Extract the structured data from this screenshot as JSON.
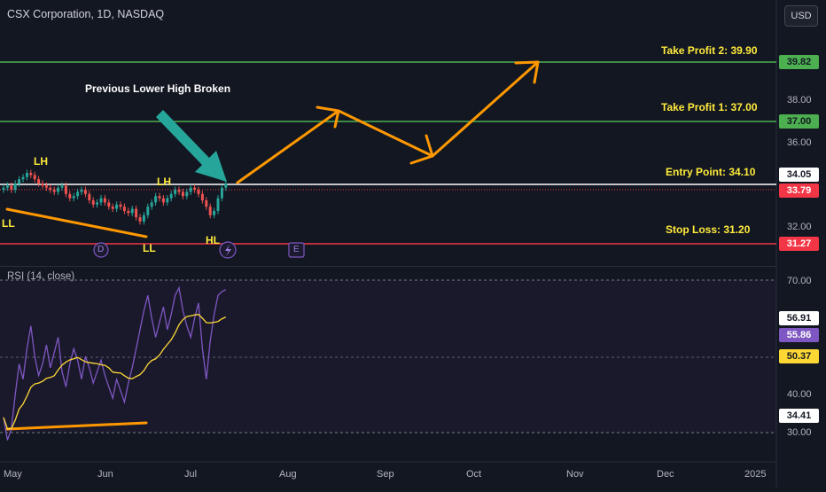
{
  "header": {
    "symbol": "CSX Corporation, 1D, NASDAQ",
    "currency_button": "USD",
    "rsi_label": "RSI (14, close)"
  },
  "annotations": {
    "take_profit_2": "Take Profit 2: 39.90",
    "take_profit_1": "Take Profit 1: 37.00",
    "entry": "Entry Point: 34.10",
    "stop_loss": "Stop Loss: 31.20",
    "broken": "Previous Lower High Broken",
    "lh1": "LH",
    "lh2": "LH",
    "ll1": "LL",
    "ll2": "LL",
    "hl": "HL",
    "event_d": "D",
    "event_e": "E"
  },
  "price_axis": {
    "labels": [
      "38.00",
      "36.00",
      "32.00",
      "70.00",
      "40.00",
      "30.00"
    ],
    "badges": {
      "tp2": "39.82",
      "tp1": "37.00",
      "entry": "34.05",
      "current": "33.79",
      "stop": "31.27",
      "rsi_a": "56.91",
      "rsi_b": "55.86",
      "rsi_ma": "50.37",
      "rsi_c": "34.41"
    }
  },
  "time_axis": [
    "May",
    "Jun",
    "Jul",
    "Aug",
    "Sep",
    "Oct",
    "Nov",
    "Dec",
    "2025"
  ],
  "colors": {
    "background": "#131722",
    "green_line": "#4caf50",
    "red_line": "#f23645",
    "entry_line": "#ffffff",
    "arrow": "#ff9800",
    "annotation_text": "#ffeb3b",
    "teal_arrow": "#26a69a",
    "rsi_line": "#7e57c2",
    "rsi_ma": "#fdd835",
    "candle_up": "#26a69a",
    "candle_down": "#ef5350"
  }
}
